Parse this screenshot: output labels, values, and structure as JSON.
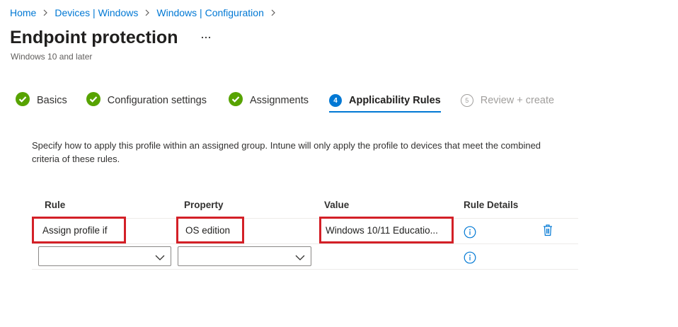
{
  "breadcrumb": {
    "items": [
      "Home",
      "Devices | Windows",
      "Windows | Configuration"
    ]
  },
  "page": {
    "title": "Endpoint protection",
    "subtitle": "Windows 10 and later",
    "more_label": "..."
  },
  "steps": [
    {
      "label": "Basics",
      "state": "complete"
    },
    {
      "label": "Configuration settings",
      "state": "complete"
    },
    {
      "label": "Assignments",
      "state": "complete"
    },
    {
      "number": "4",
      "label": "Applicability Rules",
      "state": "current"
    },
    {
      "number": "5",
      "label": "Review + create",
      "state": "pending"
    }
  ],
  "description": "Specify how to apply this profile within an assigned group. Intune will only apply the profile to devices that meet the combined criteria of these rules.",
  "table": {
    "headers": [
      "Rule",
      "Property",
      "Value",
      "Rule Details"
    ],
    "rows": [
      {
        "rule": "Assign profile if",
        "property": "OS edition",
        "value": "Windows 10/11 Educatio..."
      }
    ],
    "new_row": {
      "rule": "",
      "property": ""
    }
  },
  "colors": {
    "accent": "#0078d4",
    "success": "#57a300",
    "highlight": "#d32027"
  },
  "icons": {
    "check": "checkmark-circle-icon",
    "info": "info-icon",
    "delete": "trash-icon",
    "chevron": "chevron-down-icon"
  }
}
